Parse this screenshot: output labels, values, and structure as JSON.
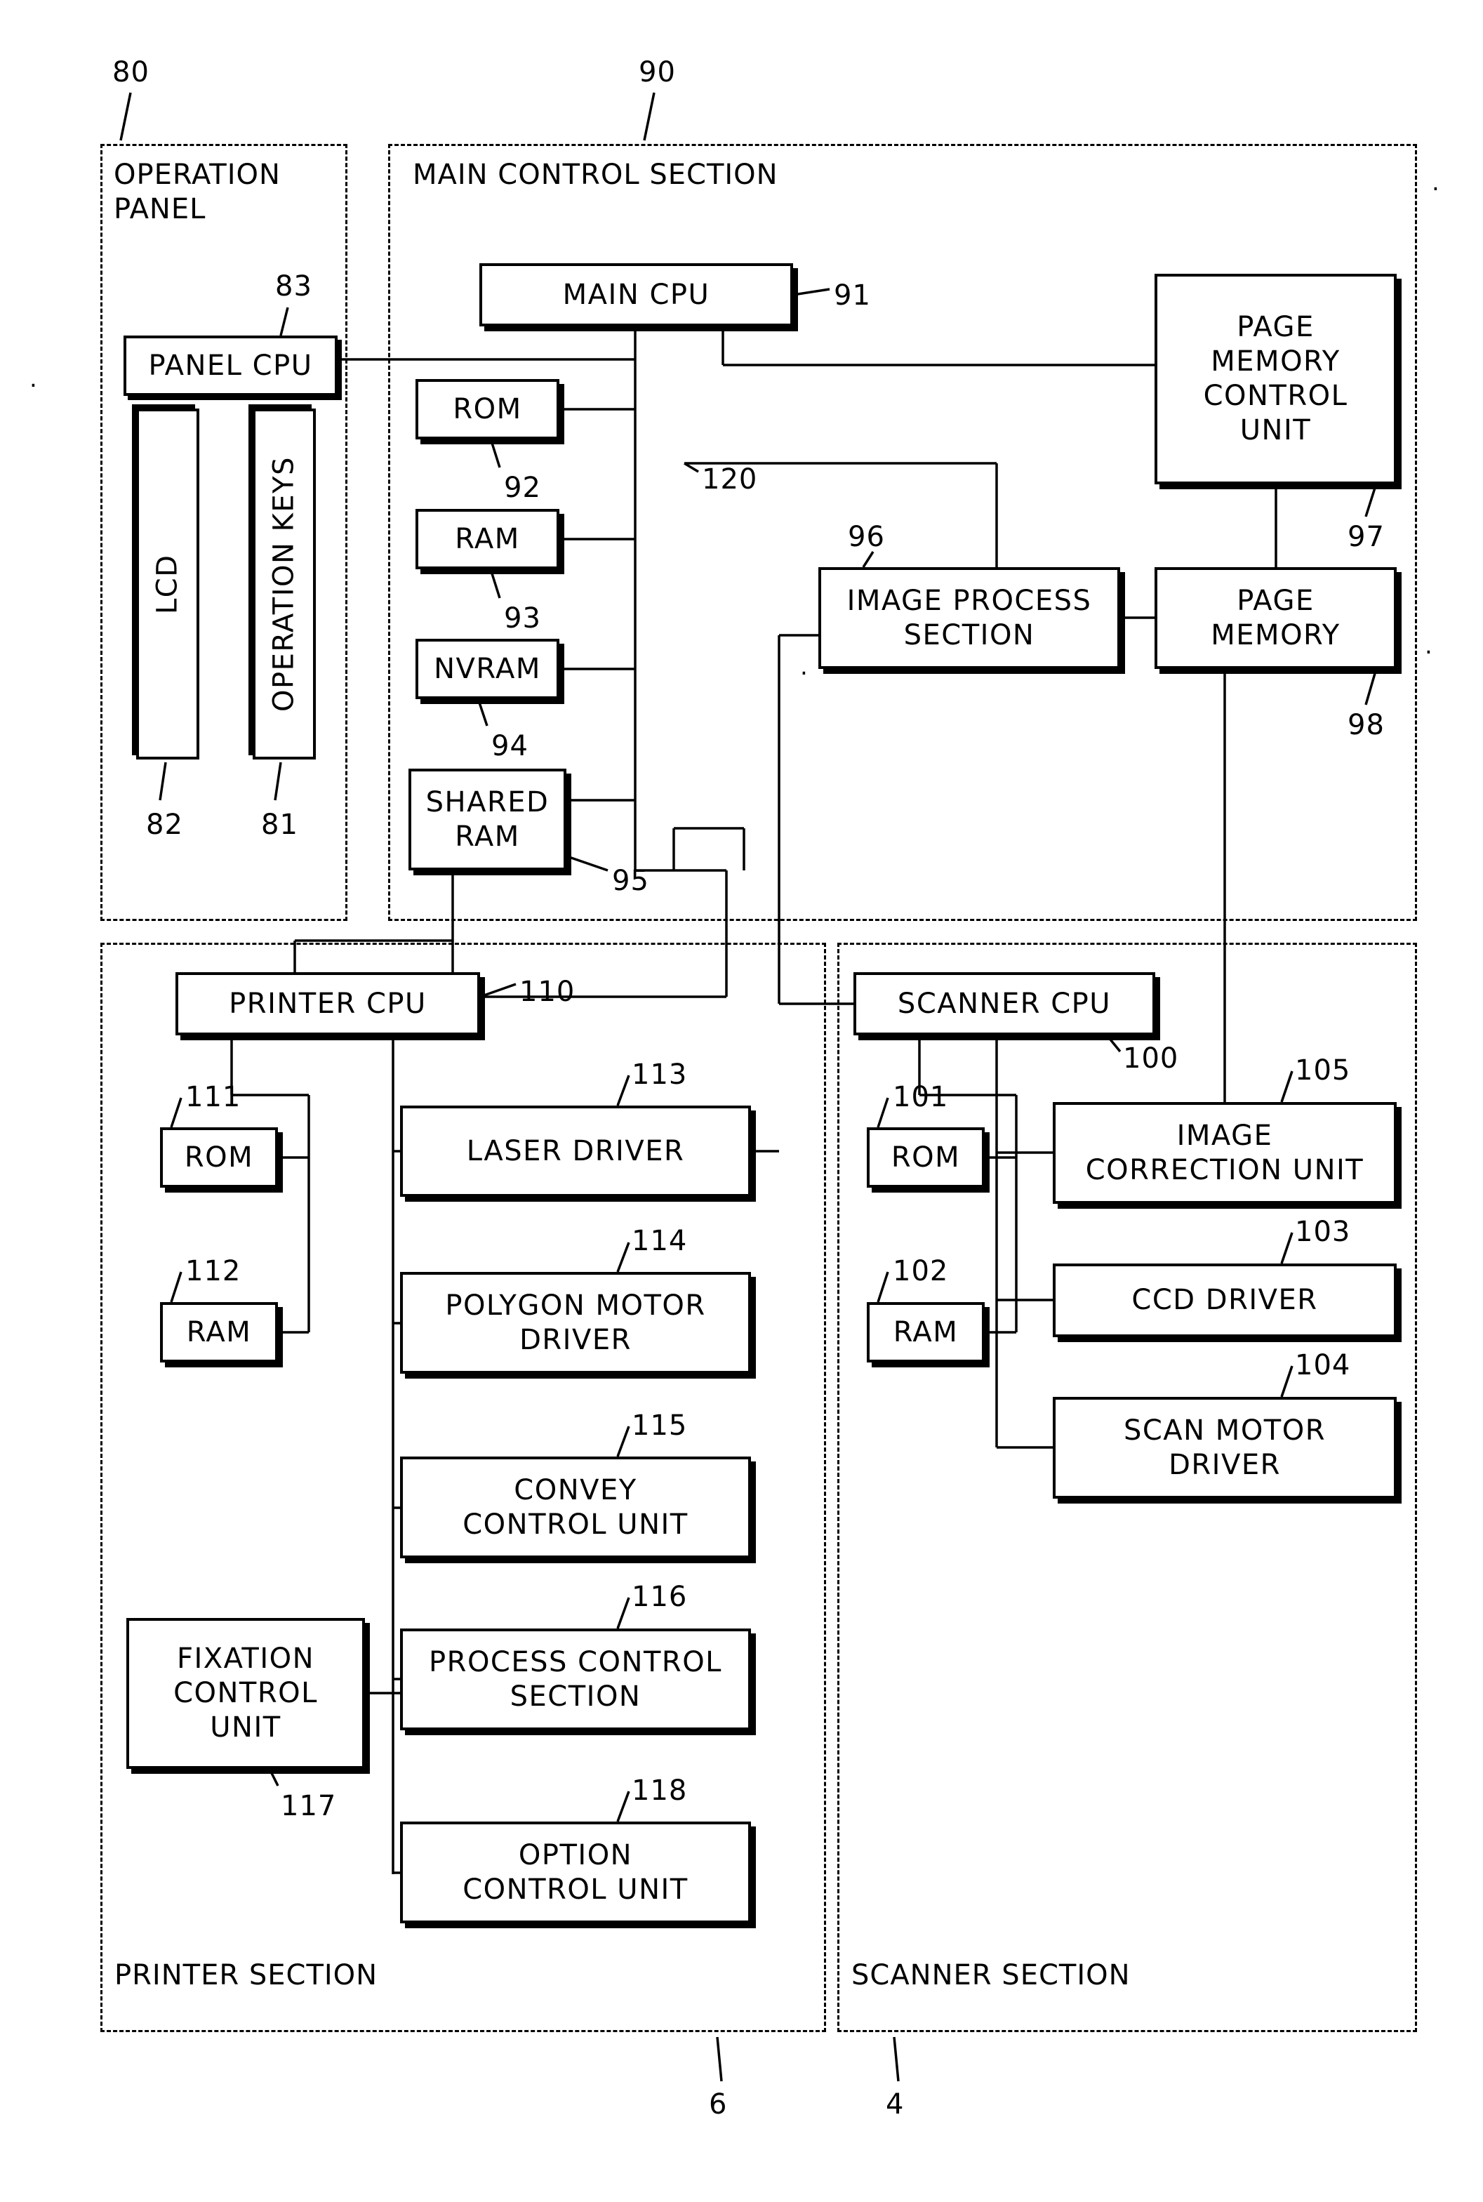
{
  "figure": {
    "sections": [
      {
        "name": "operation-panel",
        "label": "OPERATION\nPANEL",
        "ref": "80"
      },
      {
        "name": "main-control-section",
        "label": "MAIN CONTROL SECTION",
        "ref": "90"
      },
      {
        "name": "printer-section",
        "label": "PRINTER SECTION",
        "ref": "6"
      },
      {
        "name": "scanner-section",
        "label": "SCANNER SECTION",
        "ref": "4"
      }
    ],
    "blocks": [
      {
        "name": "panel-cpu",
        "label": "PANEL CPU",
        "ref": "83"
      },
      {
        "name": "lcd",
        "label": "LCD",
        "ref": "82"
      },
      {
        "name": "operation-keys",
        "label": "OPERATION KEYS",
        "ref": "81"
      },
      {
        "name": "main-cpu",
        "label": "MAIN CPU",
        "ref": "91"
      },
      {
        "name": "rom-main",
        "label": "ROM",
        "ref": "92"
      },
      {
        "name": "ram-main",
        "label": "RAM",
        "ref": "93"
      },
      {
        "name": "nvram",
        "label": "NVRAM",
        "ref": "94"
      },
      {
        "name": "shared-ram",
        "label": "SHARED\nRAM",
        "ref": "95"
      },
      {
        "name": "image-process-section",
        "label": "IMAGE PROCESS\nSECTION",
        "ref": "96"
      },
      {
        "name": "page-memory-control-unit",
        "label": "PAGE\nMEMORY\nCONTROL\nUNIT",
        "ref": "97"
      },
      {
        "name": "page-memory",
        "label": "PAGE\nMEMORY",
        "ref": "98"
      },
      {
        "name": "bus-120",
        "label": "",
        "ref": "120"
      },
      {
        "name": "printer-cpu",
        "label": "PRINTER CPU",
        "ref": "110"
      },
      {
        "name": "rom-printer",
        "label": "ROM",
        "ref": "111"
      },
      {
        "name": "ram-printer",
        "label": "RAM",
        "ref": "112"
      },
      {
        "name": "laser-driver",
        "label": "LASER DRIVER",
        "ref": "113"
      },
      {
        "name": "polygon-motor-driver",
        "label": "POLYGON MOTOR\nDRIVER",
        "ref": "114"
      },
      {
        "name": "convey-control-unit",
        "label": "CONVEY\nCONTROL UNIT",
        "ref": "115"
      },
      {
        "name": "process-control-section",
        "label": "PROCESS CONTROL\nSECTION",
        "ref": "116"
      },
      {
        "name": "fixation-control-unit",
        "label": "FIXATION\nCONTROL\nUNIT",
        "ref": "117"
      },
      {
        "name": "option-control-unit",
        "label": "OPTION\nCONTROL UNIT",
        "ref": "118"
      },
      {
        "name": "scanner-cpu",
        "label": "SCANNER CPU",
        "ref": "100"
      },
      {
        "name": "rom-scanner",
        "label": "ROM",
        "ref": "101"
      },
      {
        "name": "ram-scanner",
        "label": "RAM",
        "ref": "102"
      },
      {
        "name": "image-correction-unit",
        "label": "IMAGE\nCORRECTION UNIT",
        "ref": "105"
      },
      {
        "name": "ccd-driver",
        "label": "CCD DRIVER",
        "ref": "103"
      },
      {
        "name": "scan-motor-driver",
        "label": "SCAN MOTOR\nDRIVER",
        "ref": "104"
      }
    ]
  }
}
